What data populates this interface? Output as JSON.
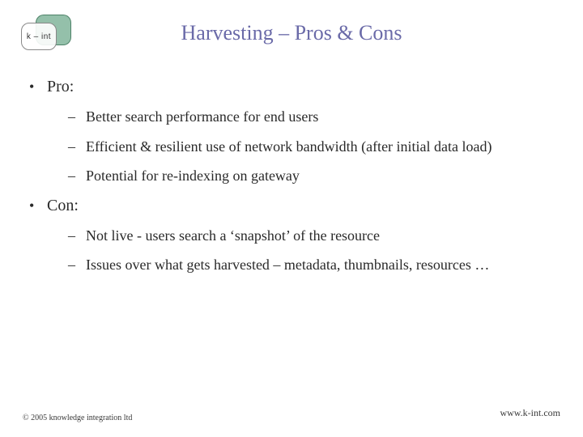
{
  "logo_text": "k – int",
  "title": "Harvesting – Pros & Cons",
  "sections": [
    {
      "label": "Pro:",
      "items": [
        "Better search performance for end users",
        "Efficient & resilient use of network bandwidth (after initial data load)",
        "Potential for re-indexing on gateway"
      ]
    },
    {
      "label": "Con:",
      "items": [
        "Not live - users search a ‘snapshot’ of the resource",
        "Issues over what gets harvested – metadata, thumbnails, resources …"
      ]
    }
  ],
  "footer": {
    "copyright": "© 2005 knowledge integration ltd",
    "url": "www.k-int.com"
  }
}
